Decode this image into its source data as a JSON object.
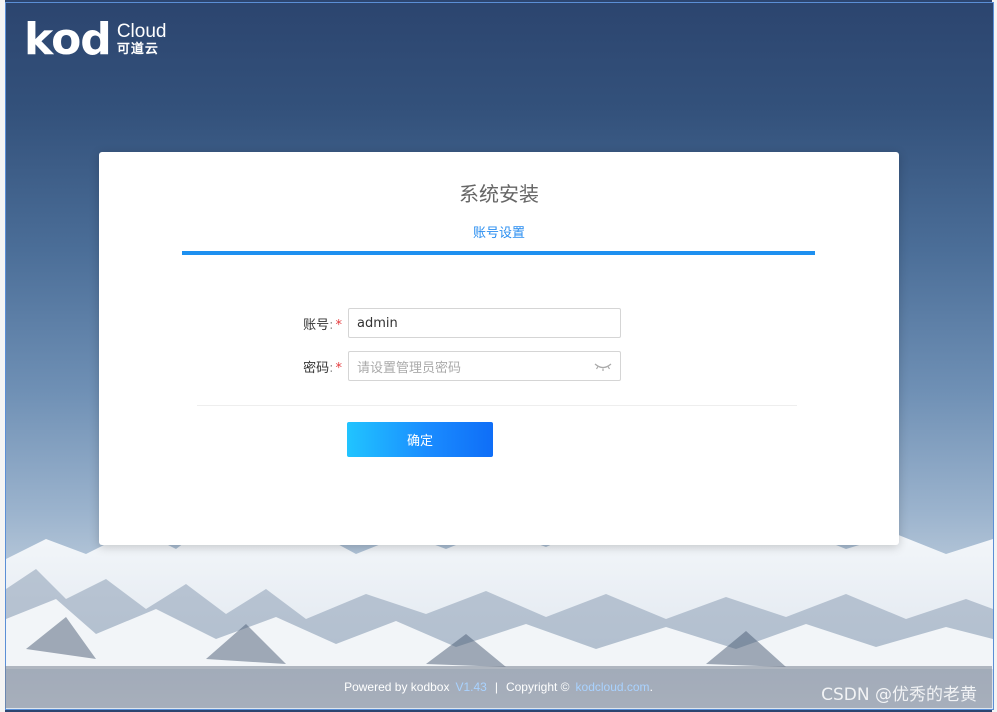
{
  "brand": {
    "logo_main": "kod",
    "logo_cloud": "Cloud",
    "logo_cn": "可道云"
  },
  "install": {
    "title": "系统安装",
    "step": "账号设置",
    "account_label": "账号",
    "account_value": "admin",
    "password_label": "密码",
    "password_placeholder": "请设置管理员密码",
    "required_mark": "*",
    "colon": ":",
    "confirm_label": "确定"
  },
  "footer": {
    "powered_by": "Powered by kodbox",
    "version": "V1.43",
    "separator": "|",
    "copyright": "Copyright ©",
    "site": "kodcloud.com",
    "period": "."
  },
  "watermark": "CSDN @优秀的老黄",
  "colors": {
    "accent": "#1e90f0",
    "required": "#e4393c",
    "link": "#a9d2ff"
  },
  "icons": [
    "eye-closed-icon"
  ]
}
